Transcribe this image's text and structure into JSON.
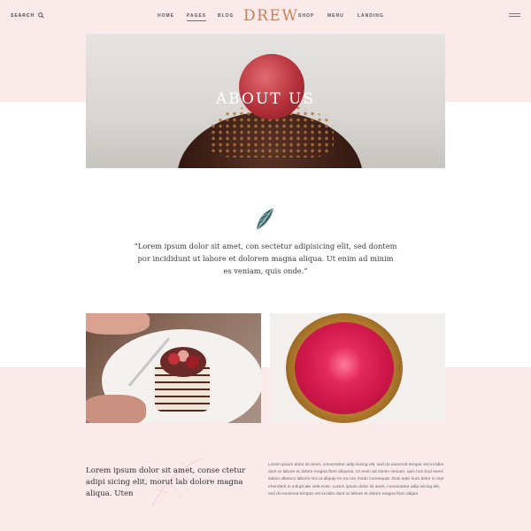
{
  "header": {
    "search_label": "SEARCH",
    "nav": {
      "home": "HOME",
      "pages": "PAGES",
      "blog": "BLOG",
      "shop": "SHOP",
      "menu": "MENU",
      "landing": "LANDING"
    },
    "logo": "DREW",
    "active_item": "PAGES",
    "accent_color": "#b5505a",
    "logo_color": "#c9815a"
  },
  "hero": {
    "title": "ABOUT US"
  },
  "quote": {
    "text": "“Lorem ipsum dolor sit amet, con sectetur adipisicing elit, sed dontem por incididunt ut labore et dolorem magna aliqua. Ut enim ad minim es veniam, quis onde.”"
  },
  "bottom": {
    "left_text": "Lorem ipsum dolor sit amet, conse ctetur adipi sicing elit, morut lab dolore magna aliqua. Uten",
    "right_text": "Lorem ipsum dolor sit amet, consectetur adip isicing elit, sed do eiusmod tempor est incidim dunt ur labore et dolore magna ftom aliquma. Ut enim ad minim veniam, quis nos trud exerc itation ullamco laboris nisi ut aliquip ex ea con modo consequat. Duis aute irure dolor in repr ehenderit in volupt ate velit esse. Lorem ipsum dolor sit amet, consectetur adip isicing elit, sed do eiusmod tempor est incidim dunt ur labore et dolore magna ftom aliqua"
  },
  "colors": {
    "band": "#fbeaea"
  },
  "icons": {
    "search": "search-icon",
    "menu": "hamburger-menu-icon",
    "leaf": "leaf-icon"
  }
}
